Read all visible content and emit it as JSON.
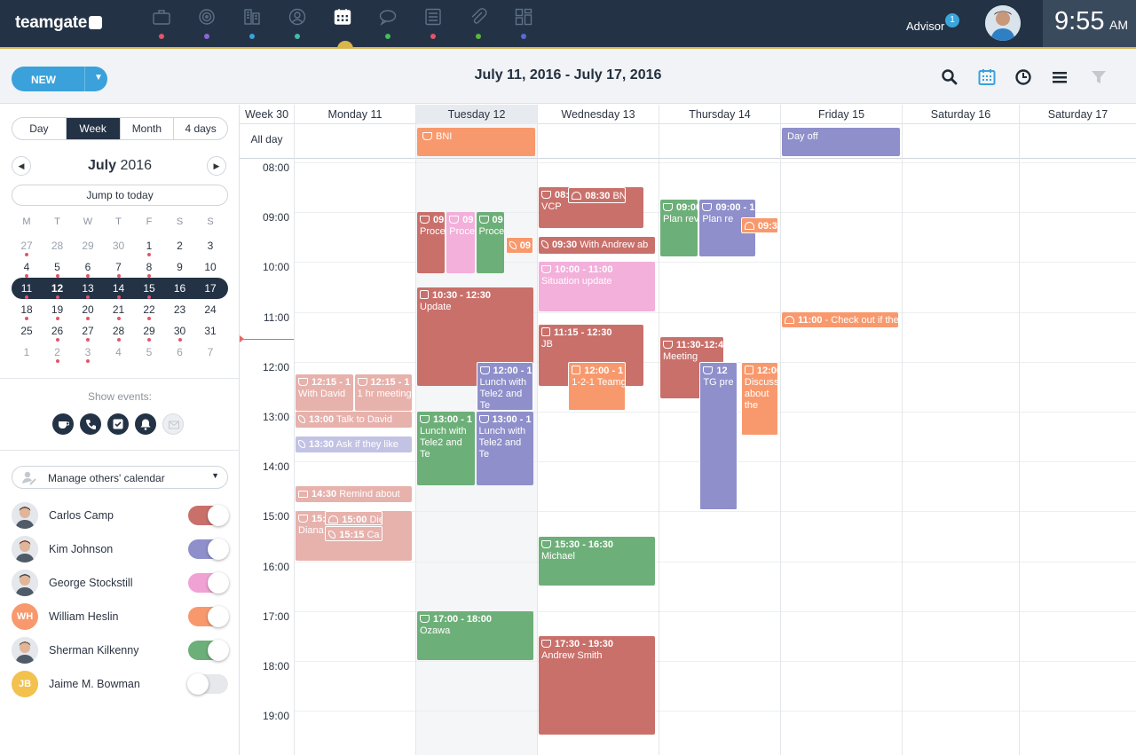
{
  "app": {
    "logo": "teamgate"
  },
  "nav": [
    {
      "icon": "briefcase-icon",
      "dot": "#e2556a"
    },
    {
      "icon": "target-icon",
      "dot": "#8a66d6"
    },
    {
      "icon": "building-icon",
      "dot": "#3aa1db"
    },
    {
      "icon": "contact-icon",
      "dot": "#3fbfa8"
    },
    {
      "icon": "calendar-icon",
      "dot": "",
      "active": true
    },
    {
      "icon": "chat-icon",
      "dot": "#3fbf5a"
    },
    {
      "icon": "list-icon",
      "dot": "#e2556a"
    },
    {
      "icon": "paperclip-icon",
      "dot": "#58b83a"
    },
    {
      "icon": "dashboard-icon",
      "dot": "#5a6ad6"
    }
  ],
  "user": {
    "name": "Advisor",
    "badge": "1"
  },
  "clock": {
    "time": "9:55",
    "ampm": "AM"
  },
  "toolbar": {
    "new_label": "NEW",
    "date_range": "July 11, 2016 - July 17, 2016"
  },
  "view_tabs": [
    "Day",
    "Week",
    "Month",
    "4 days"
  ],
  "selected_view": "Week",
  "mini_calendar": {
    "month": "July",
    "year": "2016",
    "jump_label": "Jump to today",
    "weekdays": [
      "M",
      "T",
      "W",
      "T",
      "F",
      "S",
      "S"
    ],
    "weeks": [
      [
        {
          "d": "27",
          "m": true,
          "dot": true
        },
        {
          "d": "28",
          "m": true
        },
        {
          "d": "29",
          "m": true
        },
        {
          "d": "30",
          "m": true
        },
        {
          "d": "1",
          "dot": true
        },
        {
          "d": "2"
        },
        {
          "d": "3"
        }
      ],
      [
        {
          "d": "4",
          "dot": true
        },
        {
          "d": "5",
          "dot": true
        },
        {
          "d": "6",
          "dot": true
        },
        {
          "d": "7",
          "dot": true
        },
        {
          "d": "8",
          "dot": true
        },
        {
          "d": "9"
        },
        {
          "d": "10"
        }
      ],
      [
        {
          "d": "11",
          "dot": true
        },
        {
          "d": "12",
          "dot": true,
          "today": true
        },
        {
          "d": "13",
          "dot": true
        },
        {
          "d": "14",
          "dot": true
        },
        {
          "d": "15",
          "dot": true
        },
        {
          "d": "16"
        },
        {
          "d": "17"
        }
      ],
      [
        {
          "d": "18",
          "dot": true
        },
        {
          "d": "19",
          "dot": true
        },
        {
          "d": "20",
          "dot": true
        },
        {
          "d": "21",
          "dot": true
        },
        {
          "d": "22",
          "dot": true
        },
        {
          "d": "23"
        },
        {
          "d": "24"
        }
      ],
      [
        {
          "d": "25"
        },
        {
          "d": "26",
          "dot": true
        },
        {
          "d": "27",
          "dot": true
        },
        {
          "d": "28",
          "dot": true
        },
        {
          "d": "29",
          "dot": true
        },
        {
          "d": "30",
          "dot": true
        },
        {
          "d": "31"
        }
      ],
      [
        {
          "d": "1",
          "m": true
        },
        {
          "d": "2",
          "m": true,
          "dot": true
        },
        {
          "d": "3",
          "m": true,
          "dot": true
        },
        {
          "d": "4",
          "m": true
        },
        {
          "d": "5",
          "m": true
        },
        {
          "d": "6",
          "m": true
        },
        {
          "d": "7",
          "m": true
        }
      ]
    ],
    "current_week_index": 2
  },
  "show_events": {
    "label": "Show events:",
    "filters": [
      "meeting-icon",
      "phone-icon",
      "task-icon",
      "reminder-icon",
      "email-icon"
    ],
    "active": [
      true,
      true,
      true,
      true,
      false
    ]
  },
  "manage_label": "Manage others' calendar",
  "people": [
    {
      "name": "Carlos Camp",
      "color": "#c9706b",
      "on": true,
      "avatar": "photo"
    },
    {
      "name": "Kim Johnson",
      "color": "#8f8fcb",
      "on": true,
      "avatar": "photo"
    },
    {
      "name": "George Stockstill",
      "color": "#f0a2d5",
      "on": true,
      "avatar": "photo"
    },
    {
      "name": "William Heslin",
      "color": "#f8996d",
      "on": true,
      "avatar": "WH",
      "avatar_bg": "#f8996d"
    },
    {
      "name": "Sherman Kilkenny",
      "color": "#6daf78",
      "on": true,
      "avatar": "photo"
    },
    {
      "name": "Jaime M. Bowman",
      "color": "#e6e8eb",
      "on": false,
      "avatar": "JB",
      "avatar_bg": "#f2c14e"
    }
  ],
  "calendar": {
    "week_label": "Week 30",
    "allday_label": "All day",
    "days": [
      "Monday 11",
      "Tuesday 12",
      "Wednesday 13",
      "Thursday 14",
      "Friday 15",
      "Saturday 16",
      "Saturday 17"
    ],
    "hours": [
      "08:00",
      "09:00",
      "10:00",
      "11:00",
      "12:00",
      "13:00",
      "14:00",
      "15:00",
      "16:00",
      "17:00",
      "18:00",
      "19:00"
    ],
    "allday_events": [
      {
        "day": 1,
        "title": "BNI",
        "color": "#f8996d",
        "icon": "meeting"
      },
      {
        "day": 4,
        "title": "Day off",
        "color": "#8f8fcb",
        "icon": ""
      }
    ],
    "events": [
      {
        "day": 0,
        "start": 12.25,
        "end": 13.0,
        "col": 0,
        "cols": 2,
        "time": "12:15 - 1",
        "title": "With David",
        "color": "#e7b1ac",
        "icon": "meeting"
      },
      {
        "day": 0,
        "start": 12.25,
        "end": 13.0,
        "col": 1,
        "cols": 2,
        "time": "12:15 - 1",
        "title": "1 hr meeting",
        "color": "#e7b1ac",
        "icon": "meeting"
      },
      {
        "day": 0,
        "start": 13.0,
        "end": 13.33,
        "col": 0,
        "cols": 1,
        "time": "13:00",
        "title": "Talk to David",
        "color": "#e7b1ac",
        "icon": "phone",
        "inline": true
      },
      {
        "day": 0,
        "start": 13.5,
        "end": 13.83,
        "col": 0,
        "cols": 1,
        "time": "13:30",
        "title": "Ask if they like",
        "color": "#c2c2e5",
        "icon": "phone",
        "inline": true
      },
      {
        "day": 0,
        "start": 14.5,
        "end": 14.83,
        "col": 0,
        "cols": 1,
        "time": "14:30",
        "title": "Remind about",
        "color": "#e7b1ac",
        "icon": "env",
        "inline": true
      },
      {
        "day": 0,
        "start": 15.0,
        "end": 16.0,
        "col": 0,
        "cols": 1,
        "time": "15:00 - 1",
        "title": "Diana DNB",
        "color": "#e7b1ac",
        "icon": "meeting"
      },
      {
        "day": 0,
        "start": 15.0,
        "end": 15.3,
        "col": 0.5,
        "cols": 2,
        "time": "15:00",
        "title": "Die",
        "color": "#e7b1ac",
        "icon": "bell",
        "inline": true,
        "border": true
      },
      {
        "day": 0,
        "start": 15.3,
        "end": 15.62,
        "col": 0.5,
        "cols": 2,
        "time": "15:15",
        "title": "Ca",
        "color": "#e7b1ac",
        "icon": "phone",
        "inline": true,
        "border": true
      },
      {
        "day": 1,
        "start": 9.0,
        "end": 10.25,
        "col": 0,
        "cols": 4,
        "time": "09",
        "title": "Proce",
        "color": "#c9706b",
        "icon": "meeting"
      },
      {
        "day": 1,
        "start": 9.0,
        "end": 10.25,
        "col": 1,
        "cols": 4,
        "time": "09",
        "title": "Proce",
        "color": "#f2b0da",
        "icon": "meeting"
      },
      {
        "day": 1,
        "start": 9.0,
        "end": 10.25,
        "col": 2,
        "cols": 4,
        "time": "09",
        "title": "Proces",
        "color": "#6daf78",
        "icon": "meeting"
      },
      {
        "day": 1,
        "start": 9.5,
        "end": 9.85,
        "col": 3,
        "cols": 4,
        "time": "09",
        "title": "",
        "color": "#f8996d",
        "icon": "phone",
        "inline": true,
        "border": true
      },
      {
        "day": 1,
        "start": 10.5,
        "end": 12.5,
        "col": 0,
        "cols": 1,
        "time": "10:30 - 12:30",
        "title": "Update",
        "color": "#c9706b",
        "icon": "sq"
      },
      {
        "day": 1,
        "start": 12.0,
        "end": 13.0,
        "col": 1,
        "cols": 2,
        "time": "12:00 - 1",
        "title": "Lunch with Tele2 and Te",
        "color": "#8f8fcb",
        "icon": "meeting",
        "border": true
      },
      {
        "day": 1,
        "start": 13.0,
        "end": 14.5,
        "col": 0,
        "cols": 2,
        "time": "13:00 - 1",
        "title": "Lunch with Tele2 and Te",
        "color": "#6daf78",
        "icon": "meeting"
      },
      {
        "day": 1,
        "start": 13.0,
        "end": 14.5,
        "col": 1,
        "cols": 2,
        "time": "13:00 - 1",
        "title": "Lunch with Tele2 and Te",
        "color": "#8f8fcb",
        "icon": "meeting"
      },
      {
        "day": 1,
        "start": 17.0,
        "end": 18.0,
        "col": 0,
        "cols": 1,
        "time": "17:00 - 18:00",
        "title": "Ozawa",
        "color": "#6daf78",
        "icon": "meeting"
      },
      {
        "day": 2,
        "start": 8.5,
        "end": 9.33,
        "col": 0,
        "cols": 1,
        "time": "08:30 - 0",
        "title": "VCP",
        "color": "#c9706b",
        "icon": "meeting",
        "w": 0.9
      },
      {
        "day": 2,
        "start": 8.5,
        "end": 8.83,
        "col": 0.5,
        "cols": 2,
        "time": "08:30",
        "title": "BN",
        "color": "#c9706b",
        "icon": "bell",
        "inline": true,
        "border": true
      },
      {
        "day": 2,
        "start": 9.5,
        "end": 9.85,
        "col": 0,
        "cols": 1,
        "time": "09:30",
        "title": "With Andrew ab",
        "color": "#c9706b",
        "icon": "phone",
        "inline": true
      },
      {
        "day": 2,
        "start": 10.0,
        "end": 11.0,
        "col": 0,
        "cols": 1,
        "time": "10:00 - 11:00",
        "title": "Situation update",
        "color": "#f2b0da",
        "icon": "meeting"
      },
      {
        "day": 2,
        "start": 11.25,
        "end": 12.5,
        "col": 0,
        "cols": 1,
        "time": "11:15 - 12:30",
        "title": "JB",
        "color": "#c9706b",
        "icon": "sq",
        "w": 0.9
      },
      {
        "day": 2,
        "start": 12.0,
        "end": 13.0,
        "col": 0.5,
        "cols": 2,
        "time": "12:00 - 1",
        "title": "1-2-1 Teamg",
        "color": "#f8996d",
        "icon": "sq",
        "border": true
      },
      {
        "day": 2,
        "start": 15.5,
        "end": 16.5,
        "col": 0,
        "cols": 1,
        "time": "15:30 - 16:30",
        "title": "Michael",
        "color": "#6daf78",
        "icon": "meeting"
      },
      {
        "day": 2,
        "start": 17.5,
        "end": 19.5,
        "col": 0,
        "cols": 1,
        "time": "17:30 - 19:30",
        "title": "Andrew Smith",
        "color": "#c9706b",
        "icon": "meeting"
      },
      {
        "day": 3,
        "start": 8.75,
        "end": 9.9,
        "col": 0,
        "cols": 3,
        "time": "09:00",
        "title": "Plan revi",
        "color": "#6daf78",
        "icon": "meeting"
      },
      {
        "day": 3,
        "start": 8.75,
        "end": 9.9,
        "col": 1,
        "cols": 3,
        "time": "09:00 - 1",
        "title": "Plan re",
        "color": "#8f8fcb",
        "icon": "meeting",
        "w": 1.45
      },
      {
        "day": 3,
        "start": 9.1,
        "end": 9.45,
        "col": 2.05,
        "cols": 3,
        "time": "09:30",
        "title": "",
        "color": "#f8996d",
        "icon": "bell",
        "inline": true,
        "border": true
      },
      {
        "day": 3,
        "start": 11.5,
        "end": 12.75,
        "col": 0,
        "cols": 2,
        "time": "11:30-12:4",
        "title": "Meeting",
        "color": "#c9706b",
        "icon": "meeting",
        "w": 1.1
      },
      {
        "day": 3,
        "start": 12.0,
        "end": 15.0,
        "col": 1,
        "cols": 3,
        "time": "12",
        "title": "TG pre",
        "color": "#8f8fcb",
        "icon": "meeting",
        "border": true
      },
      {
        "day": 3,
        "start": 12.0,
        "end": 13.5,
        "col": 2.05,
        "cols": 3,
        "time": "12:00",
        "title": "Discuss about the",
        "color": "#f8996d",
        "icon": "sq",
        "border": true,
        "wrap": true
      },
      {
        "day": 4,
        "start": 11.0,
        "end": 11.33,
        "col": 0,
        "cols": 1,
        "time": "11:00",
        "title": "- Check out if the",
        "color": "#f8996d",
        "icon": "bell",
        "inline": true
      }
    ]
  }
}
